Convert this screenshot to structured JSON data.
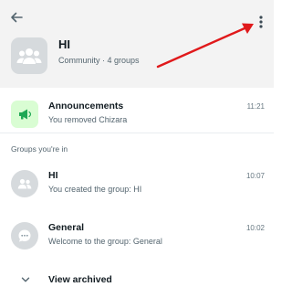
{
  "header": {
    "title": "HI",
    "subtitle": "Community · 4 groups",
    "back_icon": "arrow-left-icon",
    "menu_icon": "more-vert-icon"
  },
  "announcements": {
    "title": "Announcements",
    "subtitle": "You removed Chizara",
    "time": "11:21",
    "icon": "megaphone-icon",
    "accent": "#25d366"
  },
  "groups_section": {
    "label": "Groups you're in",
    "items": [
      {
        "title": "HI",
        "subtitle": "You created the group: HI",
        "time": "10:07",
        "icon": "group-icon"
      },
      {
        "title": "General",
        "subtitle": "Welcome to the group: General",
        "time": "10:02",
        "icon": "chat-icon"
      }
    ]
  },
  "archived": {
    "label": "View archived",
    "icon": "chevron-down-icon"
  },
  "annotation": {
    "color": "#e0191b",
    "icon": "red-arrow-annotation"
  }
}
